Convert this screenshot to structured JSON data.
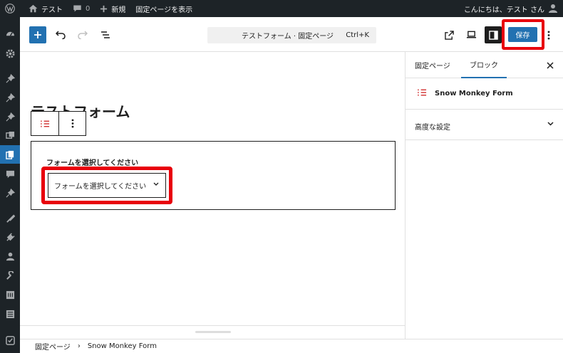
{
  "admin_bar": {
    "site_name": "テスト",
    "comments_count": "0",
    "new_label": "新規",
    "view_page_label": "固定ページを表示",
    "greeting": "こんにちは、テスト さん"
  },
  "admin_menu": {
    "items": [
      "dashboard-icon",
      "settings-icon",
      "pin-icon",
      "pin-icon",
      "pin-icon",
      "media-icon",
      "pages-icon",
      "comments-icon",
      "pin-icon",
      "appearance-icon",
      "plugins-icon",
      "users-icon",
      "tools-icon",
      "settings-icon",
      "list-icon",
      "plugin-icon"
    ],
    "current_index": 6
  },
  "toolbar": {
    "command_title": "テストフォーム · 固定ページ",
    "command_shortcut": "Ctrl+K",
    "save_label": "保存"
  },
  "canvas": {
    "post_title": "テストフォーム",
    "form_block": {
      "label": "フォームを選択してください",
      "select_value": "フォームを選択してください"
    }
  },
  "sidebar": {
    "tabs": [
      {
        "label": "固定ページ"
      },
      {
        "label": "ブロック"
      }
    ],
    "active_tab": "ブロック",
    "block_name": "Snow Monkey Form",
    "panels": [
      {
        "title": "高度な設定"
      }
    ]
  },
  "breadcrumb": {
    "items": [
      "固定ページ",
      "Snow Monkey Form"
    ],
    "separator": "›"
  },
  "colors": {
    "admin_bg": "#1d2327",
    "accent": "#2271b1",
    "highlight": "#e8000b",
    "form_icon": "#cc1818"
  }
}
